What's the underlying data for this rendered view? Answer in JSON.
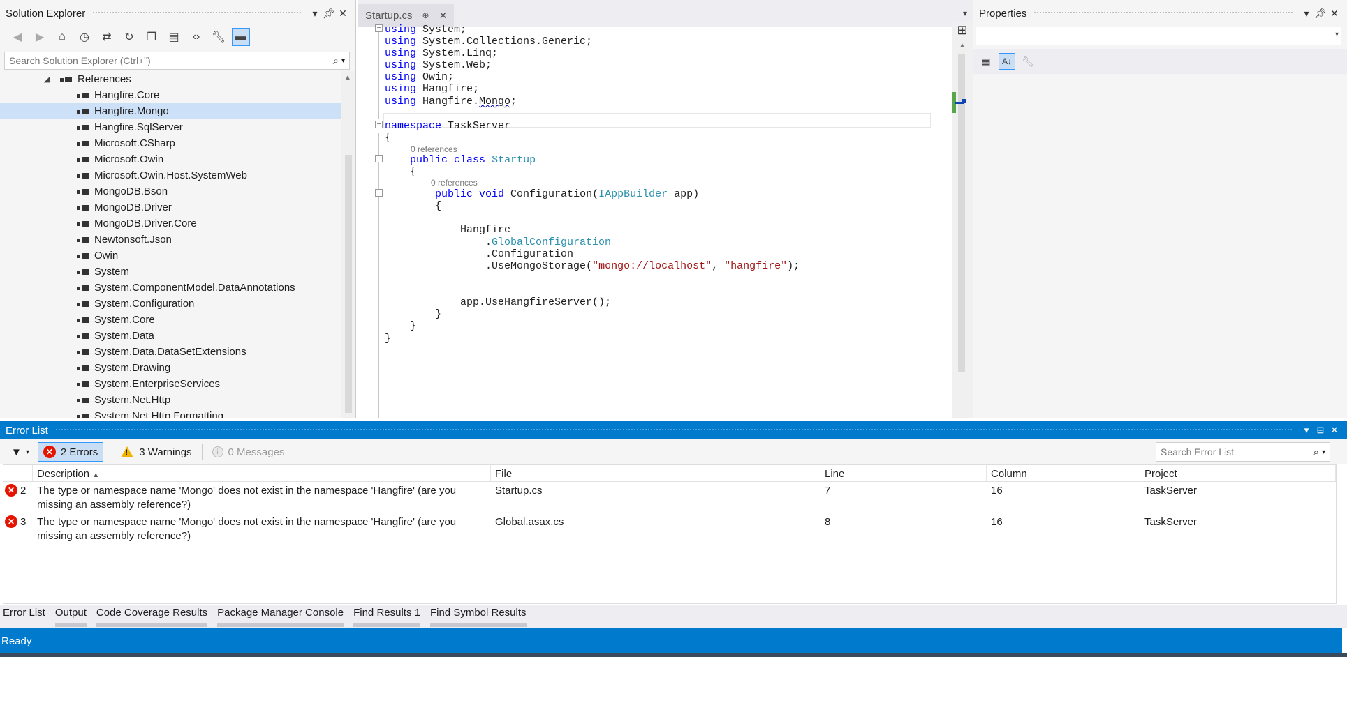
{
  "solution_explorer": {
    "title": "Solution Explorer",
    "search_placeholder": "Search Solution Explorer (Ctrl+¨)",
    "toolbar_icons": [
      "back-icon",
      "forward-icon",
      "home-icon",
      "history-icon",
      "sync-icon",
      "refresh-icon",
      "collapse-all-icon",
      "show-all-files-icon",
      "view-code-icon",
      "properties-icon",
      "preview-icon"
    ],
    "references_label": "References",
    "references": [
      "Hangfire.Core",
      "Hangfire.Mongo",
      "Hangfire.SqlServer",
      "Microsoft.CSharp",
      "Microsoft.Owin",
      "Microsoft.Owin.Host.SystemWeb",
      "MongoDB.Bson",
      "MongoDB.Driver",
      "MongoDB.Driver.Core",
      "Newtonsoft.Json",
      "Owin",
      "System",
      "System.ComponentModel.DataAnnotations",
      "System.Configuration",
      "System.Core",
      "System.Data",
      "System.Data.DataSetExtensions",
      "System.Drawing",
      "System.EnterpriseServices",
      "System.Net.Http",
      "System.Net.Http.Formatting"
    ],
    "selected_reference": "Hangfire.Mongo"
  },
  "editor": {
    "tab_label": "Startup.cs",
    "code_lens": "0 references"
  },
  "properties": {
    "title": "Properties"
  },
  "error_list": {
    "title": "Error List",
    "errors_label": "2 Errors",
    "warnings_label": "3 Warnings",
    "messages_label": "0 Messages",
    "search_placeholder": "Search Error List",
    "columns": [
      "Description",
      "File",
      "Line",
      "Column",
      "Project"
    ],
    "rows": [
      {
        "code": "2",
        "description": "The type or namespace name 'Mongo' does not exist in the namespace 'Hangfire' (are you missing an assembly reference?)",
        "file": "Startup.cs",
        "line": "7",
        "column": "16",
        "project": "TaskServer"
      },
      {
        "code": "3",
        "description": "The type or namespace name 'Mongo' does not exist in the namespace 'Hangfire' (are you missing an assembly reference?)",
        "file": "Global.asax.cs",
        "line": "8",
        "column": "16",
        "project": "TaskServer"
      }
    ]
  },
  "bottom_tabs": [
    "Error List",
    "Output",
    "Code Coverage Results",
    "Package Manager Console",
    "Find Results 1",
    "Find Symbol Results"
  ],
  "status": {
    "text": "Ready"
  },
  "colors": {
    "accent": "#007acc",
    "keyword": "#0000ff",
    "type": "#2b91af",
    "string": "#a31515",
    "error": "#e51400",
    "warning": "#f0b400"
  }
}
